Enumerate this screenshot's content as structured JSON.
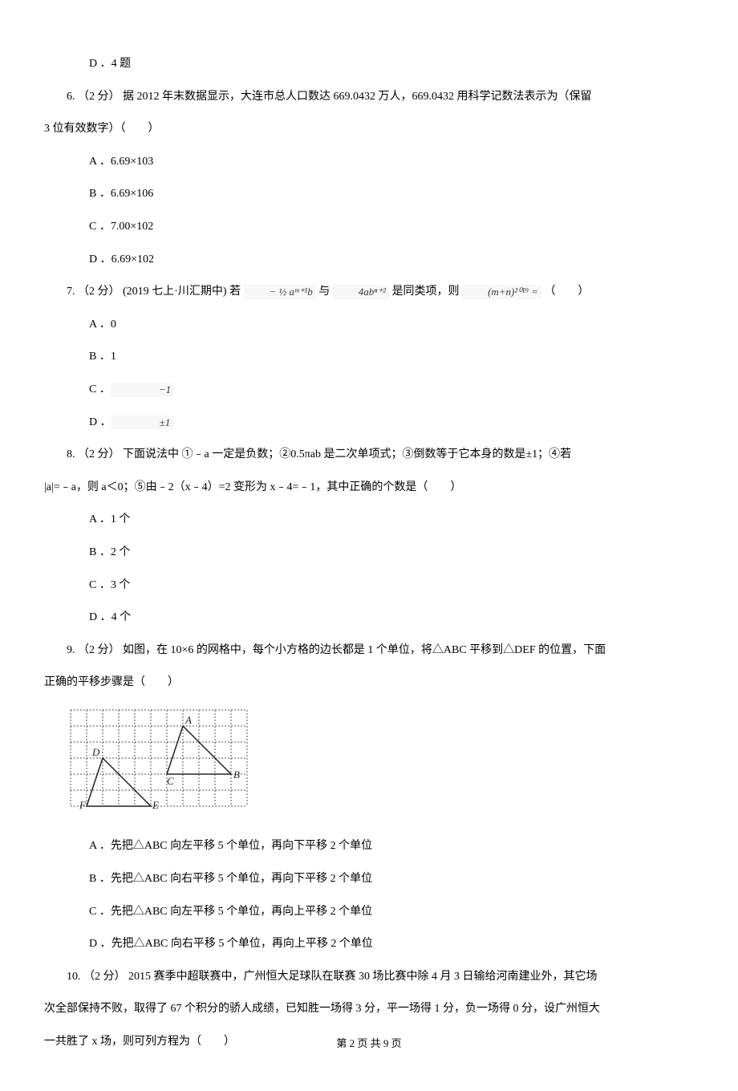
{
  "q5": {
    "optD": "D ．4 题"
  },
  "q6": {
    "stem": "6. （2 分） 据 2012 年末数据显示，大连市总人口数达 669.0432 万人，669.0432 用科学记数法表示为（保留",
    "stem2": "3 位有效数字）（　　）",
    "optA": "A ．6.69×103",
    "optB": "B ．6.69×106",
    "optC": "C ．7.00×102",
    "optD": "D ．6.69×102"
  },
  "q7": {
    "stem_a": "7. （2 分） (2019 七上·川汇期中) 若 ",
    "math1": "− ½ aᵐ⁺¹b",
    "stem_b": " 与 ",
    "math2": "4abⁿ⁺²",
    "stem_c": " 是同类项，则 ",
    "math3": "(m+n)²⁰¹⁹ =",
    "stem_d": " （　　）",
    "optA": "A ．0",
    "optB": "B ．1",
    "optC_pre": "C ．",
    "optC_math": "−1",
    "optD_pre": "D ．",
    "optD_math": "±1"
  },
  "q8": {
    "stem1": "8. （2 分） 下面说法中 ①﹣a 一定是负数；②0.5πab 是二次单项式；③倒数等于它本身的数是±1；④若",
    "stem2": "|a|=﹣a，则 a＜0；⑤由﹣2（x﹣4）=2 变形为 x﹣4=﹣1，其中正确的个数是（　　）",
    "optA": "A ．1 个",
    "optB": "B ．2 个",
    "optC": "C ．3 个",
    "optD": "D ．4 个"
  },
  "q9": {
    "stem1": "9. （2 分） 如图，在 10×6 的网格中，每个小方格的边长都是 1 个单位，将△ABC 平移到△DEF 的位置，下面",
    "stem2": "正确的平移步骤是（　　）",
    "optA": "A ．先把△ABC 向左平移 5 个单位，再向下平移 2 个单位",
    "optB": "B ．先把△ABC 向右平移 5 个单位，再向下平移 2 个单位",
    "optC": "C ．先把△ABC 向左平移 5 个单位，再向上平移 2 个单位",
    "optD": "D ．先把△ABC 向右平移 5 个单位，再向上平移 2 个单位"
  },
  "q10": {
    "stem1": "10. （2 分） 2015 赛季中超联赛中，广州恒大足球队在联赛 30 场比赛中除 4 月 3 日输给河南建业外，其它场",
    "stem2": "次全部保持不败，取得了 67 个积分的骄人成绩，已知胜一场得 3 分，平一场得 1 分，负一场得 0 分，设广州恒大",
    "stem3": "一共胜了 x 场，则可列方程为（　　）"
  },
  "footer": "第 2 页 共 9 页",
  "diagram": {
    "labels": {
      "A": "A",
      "B": "B",
      "C": "C",
      "D": "D",
      "E": "E",
      "F": "F"
    }
  }
}
